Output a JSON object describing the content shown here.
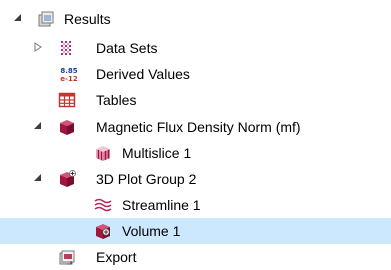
{
  "tree": {
    "items": [
      {
        "label": "Results",
        "icon": "results-folder-icon",
        "expanded": true
      },
      {
        "label": "Data Sets",
        "icon": "data-sets-icon",
        "expanded": false
      },
      {
        "label": "Derived Values",
        "icon": "derived-values-icon",
        "badge_text": "8.85 e-12"
      },
      {
        "label": "Tables",
        "icon": "tables-icon"
      },
      {
        "label": "Magnetic Flux Density Norm (mf)",
        "icon": "plot-group-3d-icon",
        "expanded": true
      },
      {
        "label": "Multislice 1",
        "icon": "multislice-icon"
      },
      {
        "label": "3D Plot Group 2",
        "icon": "plot-group-3d-icon",
        "expanded": true
      },
      {
        "label": "Streamline 1",
        "icon": "streamline-icon"
      },
      {
        "label": "Volume 1",
        "icon": "volume-icon",
        "selected": true
      },
      {
        "label": "Export",
        "icon": "export-icon"
      }
    ]
  },
  "colors": {
    "selection": "#cce8ff",
    "plot_group": "#a0163c",
    "tables_red": "#c0392b",
    "derived_blue": "#1f3f8f"
  }
}
